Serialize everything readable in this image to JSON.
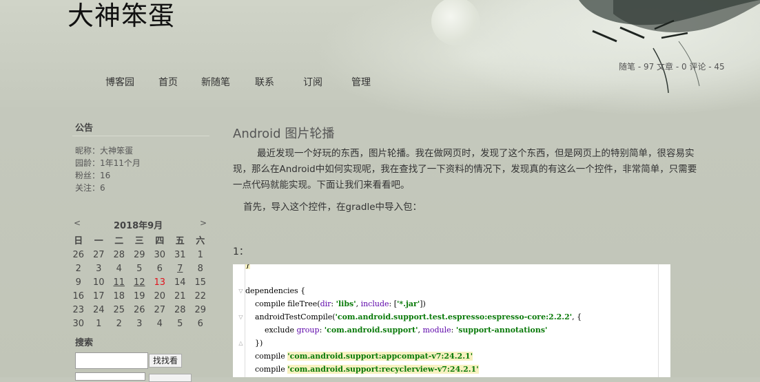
{
  "site": {
    "title": "大神笨蛋",
    "stats": "随笔 - 97  文章 - 0  评论 - 45"
  },
  "nav": [
    {
      "label": "博客园"
    },
    {
      "label": "首页"
    },
    {
      "label": "新随笔"
    },
    {
      "label": "联系"
    },
    {
      "label": "订阅"
    },
    {
      "label": "管理"
    }
  ],
  "sidebar": {
    "notice_heading": "公告",
    "profile": [
      "昵称：大神笨蛋",
      "园龄：1年11个月",
      "粉丝：16",
      "关注：6"
    ],
    "calendar": {
      "prev": "<",
      "title": "2018年9月",
      "next": ">",
      "weekdays": [
        "日",
        "一",
        "二",
        "三",
        "四",
        "五",
        "六"
      ],
      "weeks": [
        [
          "26",
          "27",
          "28",
          "29",
          "30",
          "31",
          "1"
        ],
        [
          "2",
          "3",
          "4",
          "5",
          "6",
          "7",
          "8"
        ],
        [
          "9",
          "10",
          "11",
          "12",
          "13",
          "14",
          "15"
        ],
        [
          "16",
          "17",
          "18",
          "19",
          "20",
          "21",
          "22"
        ],
        [
          "23",
          "24",
          "25",
          "26",
          "27",
          "28",
          "29"
        ],
        [
          "30",
          "1",
          "2",
          "3",
          "4",
          "5",
          "6"
        ]
      ],
      "linked_days": [
        "7",
        "11",
        "12"
      ],
      "today": "13"
    },
    "search_heading": "搜索",
    "search_button": "找找看",
    "search_value": ""
  },
  "post": {
    "title": "Android 图片轮播",
    "paragraph1": "最近发现一个好玩的东西，图片轮播。我在做网页时，发现了这个东西，但是网页上的特别简单，很容易实现，那么在Android中如何实现呢，我在查找了一下资料的情况下，发现真的有这么一个控件，非常简单，只需要一点代码就能实现。下面让我们来看看吧。",
    "paragraph2": "首先，导入这个控件，在gradle中导入包：",
    "step_label": "1：",
    "code": {
      "brace": "}",
      "l1": "dependencies {",
      "l2_pre": "    compile fileTree(",
      "l2_kw1": "dir",
      "l2_mid1": ": ",
      "l2_s1": "'libs'",
      "l2_mid2": ", ",
      "l2_kw2": "include",
      "l2_mid3": ": [",
      "l2_s2": "'*.jar'",
      "l2_end": "])",
      "l3_pre": "    androidTestCompile(",
      "l3_s": "'com.android.support.test.espresso:espresso-core:2.2.2'",
      "l3_end": ", {",
      "l4_pre": "        exclude ",
      "l4_kw1": "group",
      "l4_mid1": ": ",
      "l4_s1": "'com.android.support'",
      "l4_mid2": ", ",
      "l4_kw2": "module",
      "l4_mid3": ": ",
      "l4_s2": "'support-annotations'",
      "l5": "    })",
      "l6_pre": "    compile ",
      "l6_s": "'com.android.support:appcompat-v7:24.2.1'",
      "l7_pre": "    compile ",
      "l7_s": "'com.android.support:recyclerview-v7:24.2.1'"
    }
  }
}
